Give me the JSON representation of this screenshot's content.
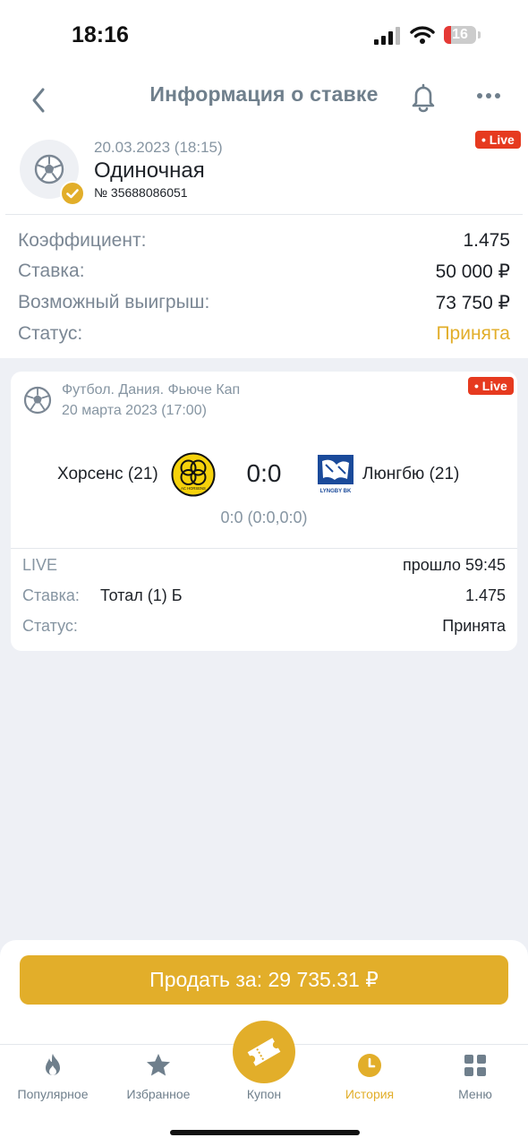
{
  "status_bar": {
    "time": "18:16",
    "battery": "16"
  },
  "header": {
    "title": "Информация о ставке"
  },
  "bet": {
    "datetime": "20.03.2023 (18:15)",
    "type": "Одиночная",
    "number": "№ 35688086051",
    "live_badge": "• Live",
    "rows": [
      {
        "label": "Коэффициент:",
        "value": "1.475"
      },
      {
        "label": "Ставка:",
        "value": "50 000 ₽"
      },
      {
        "label": "Возможный выигрыш:",
        "value": "73 750 ₽"
      },
      {
        "label": "Статус:",
        "value": "Принята"
      }
    ]
  },
  "event": {
    "league": "Футбол. Дания. Фьюче Кап",
    "date": "20 марта 2023 (17:00)",
    "live_badge": "• Live",
    "home_team": "Хорсенс (21)",
    "away_team": "Люнгбю (21)",
    "home_logo_text": "AC HORSENS",
    "away_logo_text": "LYNGBY BK",
    "score": "0:0",
    "score_detail": "0:0 (0:0,0:0)",
    "live_label": "LIVE",
    "elapsed": "прошло 59:45",
    "stake_label": "Ставка:",
    "market": "Тотал (1) Б",
    "odds": "1.475",
    "status_label": "Статус:",
    "status_value": "Принята"
  },
  "sell": {
    "label": "Продать за: 29 735.31 ₽"
  },
  "tabs": [
    {
      "label": "Популярное",
      "icon": "flame-icon"
    },
    {
      "label": "Избранное",
      "icon": "star-icon"
    },
    {
      "label": "Купон",
      "icon": "ticket-icon"
    },
    {
      "label": "История",
      "icon": "clock-icon",
      "active": true
    },
    {
      "label": "Меню",
      "icon": "grid-icon"
    }
  ],
  "colors": {
    "accent": "#e2ae2a",
    "live": "#e63a1f",
    "muted": "#8695a2"
  }
}
